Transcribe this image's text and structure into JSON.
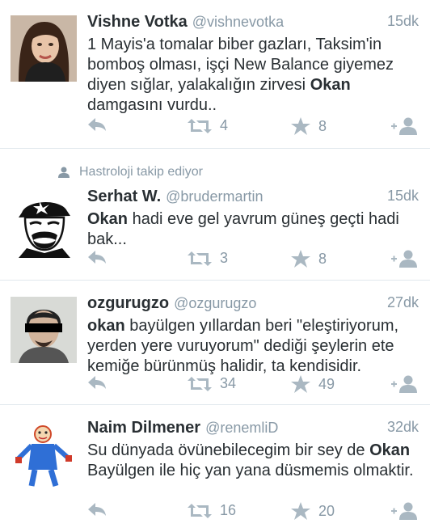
{
  "colors": {
    "text": "#292f33",
    "muted": "#8899a6",
    "icon": "#aab8c2",
    "divider": "#e1e8ed"
  },
  "tweets": [
    {
      "name": "Vishne Votka",
      "handle": "@vishnevotka",
      "time": "15dk",
      "social_context": "",
      "text_parts": [
        {
          "t": "1 Mayis'a tomalar biber gazları, Taksim'in bomboş olması, işçi New Balance  giyemez diyen sığlar, yalakalığın zirvesi ",
          "b": false
        },
        {
          "t": "Okan",
          "b": true
        },
        {
          "t": " damgasını vurdu..",
          "b": false
        }
      ],
      "retweets": "4",
      "favorites": "8",
      "avatar": "woman-portrait"
    },
    {
      "name": "Serhat W.",
      "handle": "@brudermartin",
      "time": "15dk",
      "social_context": "Hastroloji takip ediyor",
      "text_parts": [
        {
          "t": "Okan",
          "b": true
        },
        {
          "t": " hadi eve gel yavrum güneş geçti hadi bak...",
          "b": false
        }
      ],
      "retweets": "3",
      "favorites": "8",
      "avatar": "bw-cartoon-face"
    },
    {
      "name": "ozgurugzo",
      "handle": "@ozgurugzo",
      "time": "27dk",
      "social_context": "",
      "text_parts": [
        {
          "t": "okan",
          "b": true
        },
        {
          "t": " bayülgen yıllardan beri \"eleştiriyorum, yerden yere vuruyorum\" dediği şeylerin ete kemiğe bürünmüş halidir, ta kendisidir.",
          "b": false
        }
      ],
      "retweets": "34",
      "favorites": "49",
      "avatar": "censored-face"
    },
    {
      "name": "Naim Dilmener",
      "handle": "@renemliD",
      "time": "32dk",
      "social_context": "",
      "text_parts": [
        {
          "t": "Su dünyada övünebilecegim bir sey de ",
          "b": false
        },
        {
          "t": "Okan",
          "b": true
        },
        {
          "t": " Bayülgen ile hiç yan yana düsmemis olmaktir.",
          "b": false
        }
      ],
      "retweets": "16",
      "favorites": "20",
      "avatar": "child-drawing"
    }
  ]
}
